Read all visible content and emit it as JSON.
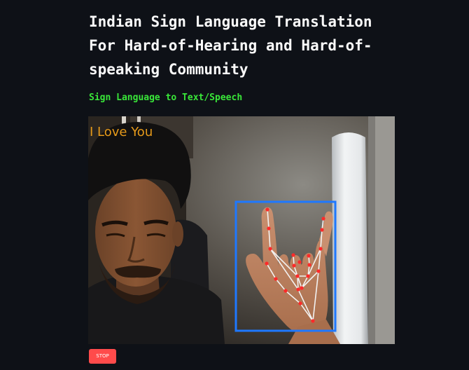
{
  "page": {
    "title": "Indian Sign Language Translation\nFor Hard-of-Hearing and Hard-of-\nspeaking Community",
    "subtitle": "Sign Language to Text/Speech"
  },
  "video": {
    "prediction": "I Love You",
    "camera_feed": "webcam-frame",
    "detection_box": "hand-bounding-box",
    "landmarks_icon": "hand-landmarks-icon"
  },
  "controls": {
    "stop_label": "STOP"
  },
  "colors": {
    "background": "#0e1117",
    "title": "#fafafa",
    "subtitle": "#39e639",
    "prediction": "#e69a1a",
    "detection_box": "#1e78ff",
    "landmark_point": "#ff2a2a",
    "landmark_line": "#f2f2f2",
    "stop_button": "#ff4b4b",
    "stop_text": "#ffffff"
  }
}
